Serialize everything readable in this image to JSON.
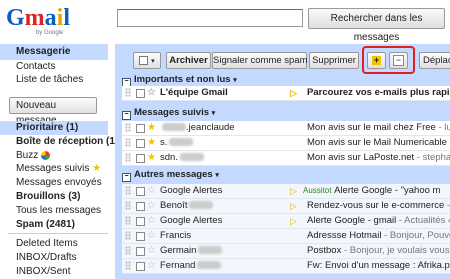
{
  "logo": {
    "text": "Gmail",
    "sub": "by Google"
  },
  "search": {
    "placeholder": "",
    "button": "Rechercher dans les messages"
  },
  "sidebar": {
    "items": [
      {
        "label": "Messagerie"
      },
      {
        "label": "Contacts"
      },
      {
        "label": "Liste de tâches"
      }
    ],
    "compose": "Nouveau message",
    "folders": [
      {
        "label": "Prioritaire (1)"
      },
      {
        "label": "Boîte de réception (1)"
      },
      {
        "label": "Buzz"
      },
      {
        "label": "Messages suivis"
      },
      {
        "label": "Messages envoyés"
      },
      {
        "label": "Brouillons (3)"
      },
      {
        "label": "Tous les messages"
      },
      {
        "label": "Spam (2481)"
      },
      {
        "label": "Deleted Items"
      },
      {
        "label": "INBOX/Drafts"
      },
      {
        "label": "INBOX/Sent"
      }
    ]
  },
  "toolbar": {
    "select": "▾",
    "archive": "Archiver",
    "spam": "Signaler comme spam",
    "delete": "Supprimer",
    "mark_important": "+",
    "mark_unimportant": "−",
    "move": "Déplace"
  },
  "sections": {
    "important": "Importants et non lus",
    "starred": "Messages suivis",
    "others": "Autres messages"
  },
  "rows_important": [
    {
      "sender": "L'équipe Gmail",
      "subject": "Parcourez vos e-mails plus rapid"
    }
  ],
  "rows_starred": [
    {
      "sender": ".jeanclaude",
      "subject": "Mon avis sur le mail chez Free",
      "snippet": " - lucie"
    },
    {
      "sender": "s.",
      "subject": "Mon avis sur le Mail Numericable",
      "snippet": " - "
    },
    {
      "sender": "sdn.",
      "subject": "Mon avis sur LaPoste.net",
      "snippet": " - stephan"
    }
  ],
  "rows_others": [
    {
      "sender": "Google Alertes",
      "label": "Aussitot",
      "subject": "Alerte Google - \"yahoo m"
    },
    {
      "sender": "Benoît",
      "subject": "Rendez-vous sur le e-commerce",
      "snippet": " - S"
    },
    {
      "sender": "Google Alertes",
      "subject": "Alerte Google - gmail",
      "snippet": " - Actualités 4"
    },
    {
      "sender": "Francis",
      "subject": "Adressse Hotmail",
      "snippet": " - Bonjour, Pouve"
    },
    {
      "sender": "Germain",
      "subject": "Postbox",
      "snippet": " - Bonjour, je voulais vous"
    },
    {
      "sender": "Fernand",
      "subject": "Fw: Envoi d'un message : Afrika.pp"
    }
  ]
}
